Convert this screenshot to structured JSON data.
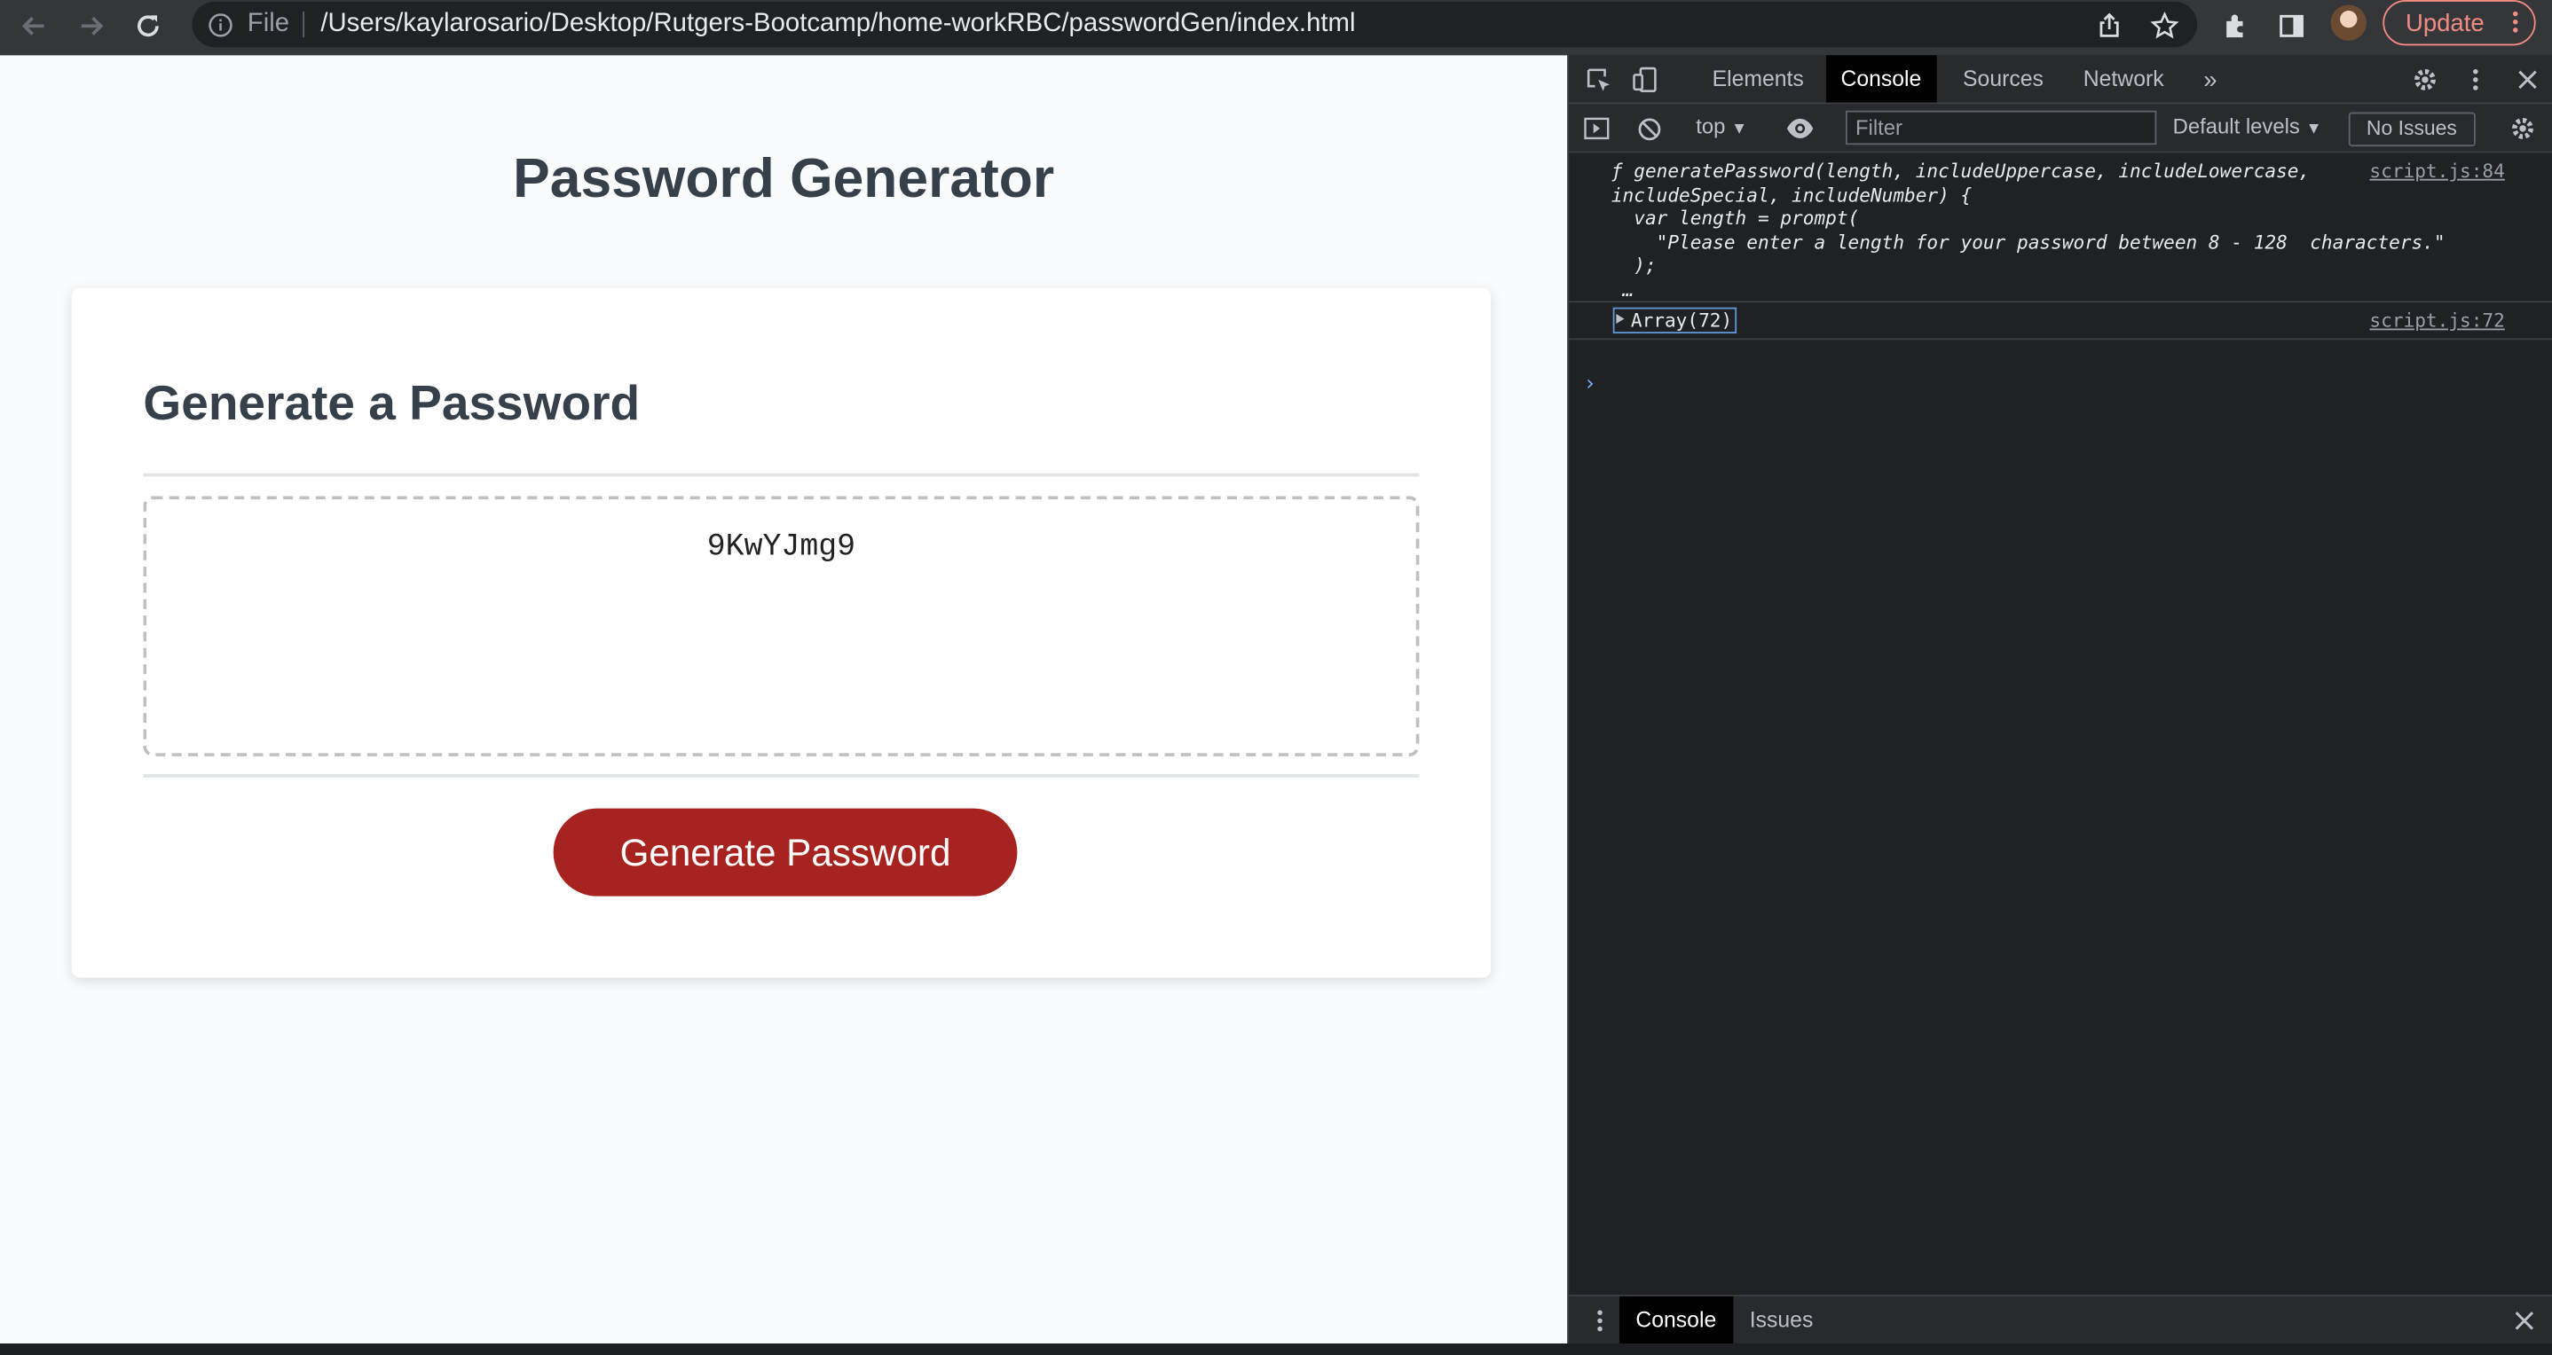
{
  "browser": {
    "scheme_label": "File",
    "url": "/Users/kaylarosario/Desktop/Rutgers-Bootcamp/home-workRBC/passwordGen/index.html",
    "update_label": "Update"
  },
  "page": {
    "title": "Password Generator",
    "card_title": "Generate a Password",
    "password_value": "9KwYJmg9",
    "generate_button_label": "Generate Password",
    "accent_color": "#a7231f"
  },
  "devtools": {
    "tabs": [
      "Elements",
      "Console",
      "Sources",
      "Network"
    ],
    "active_tab": "Console",
    "context": "top",
    "filter_placeholder": "Filter",
    "levels_label": "Default levels",
    "issues_label": "No Issues",
    "console": {
      "entry1_lines": [
        "ƒ generatePassword(length, includeUppercase, includeLowercase,",
        "includeSpecial, includeNumber) {",
        "  var length = prompt(",
        "    \"Please enter a length for your password between 8 - 128  characters.\"",
        "  );",
        "",
        " …"
      ],
      "entry1_source": "script.js:84",
      "entry2_text": "Array(72)",
      "entry2_source": "script.js:72",
      "prompt_symbol": "›"
    },
    "drawer_tabs": [
      "Console",
      "Issues"
    ]
  }
}
